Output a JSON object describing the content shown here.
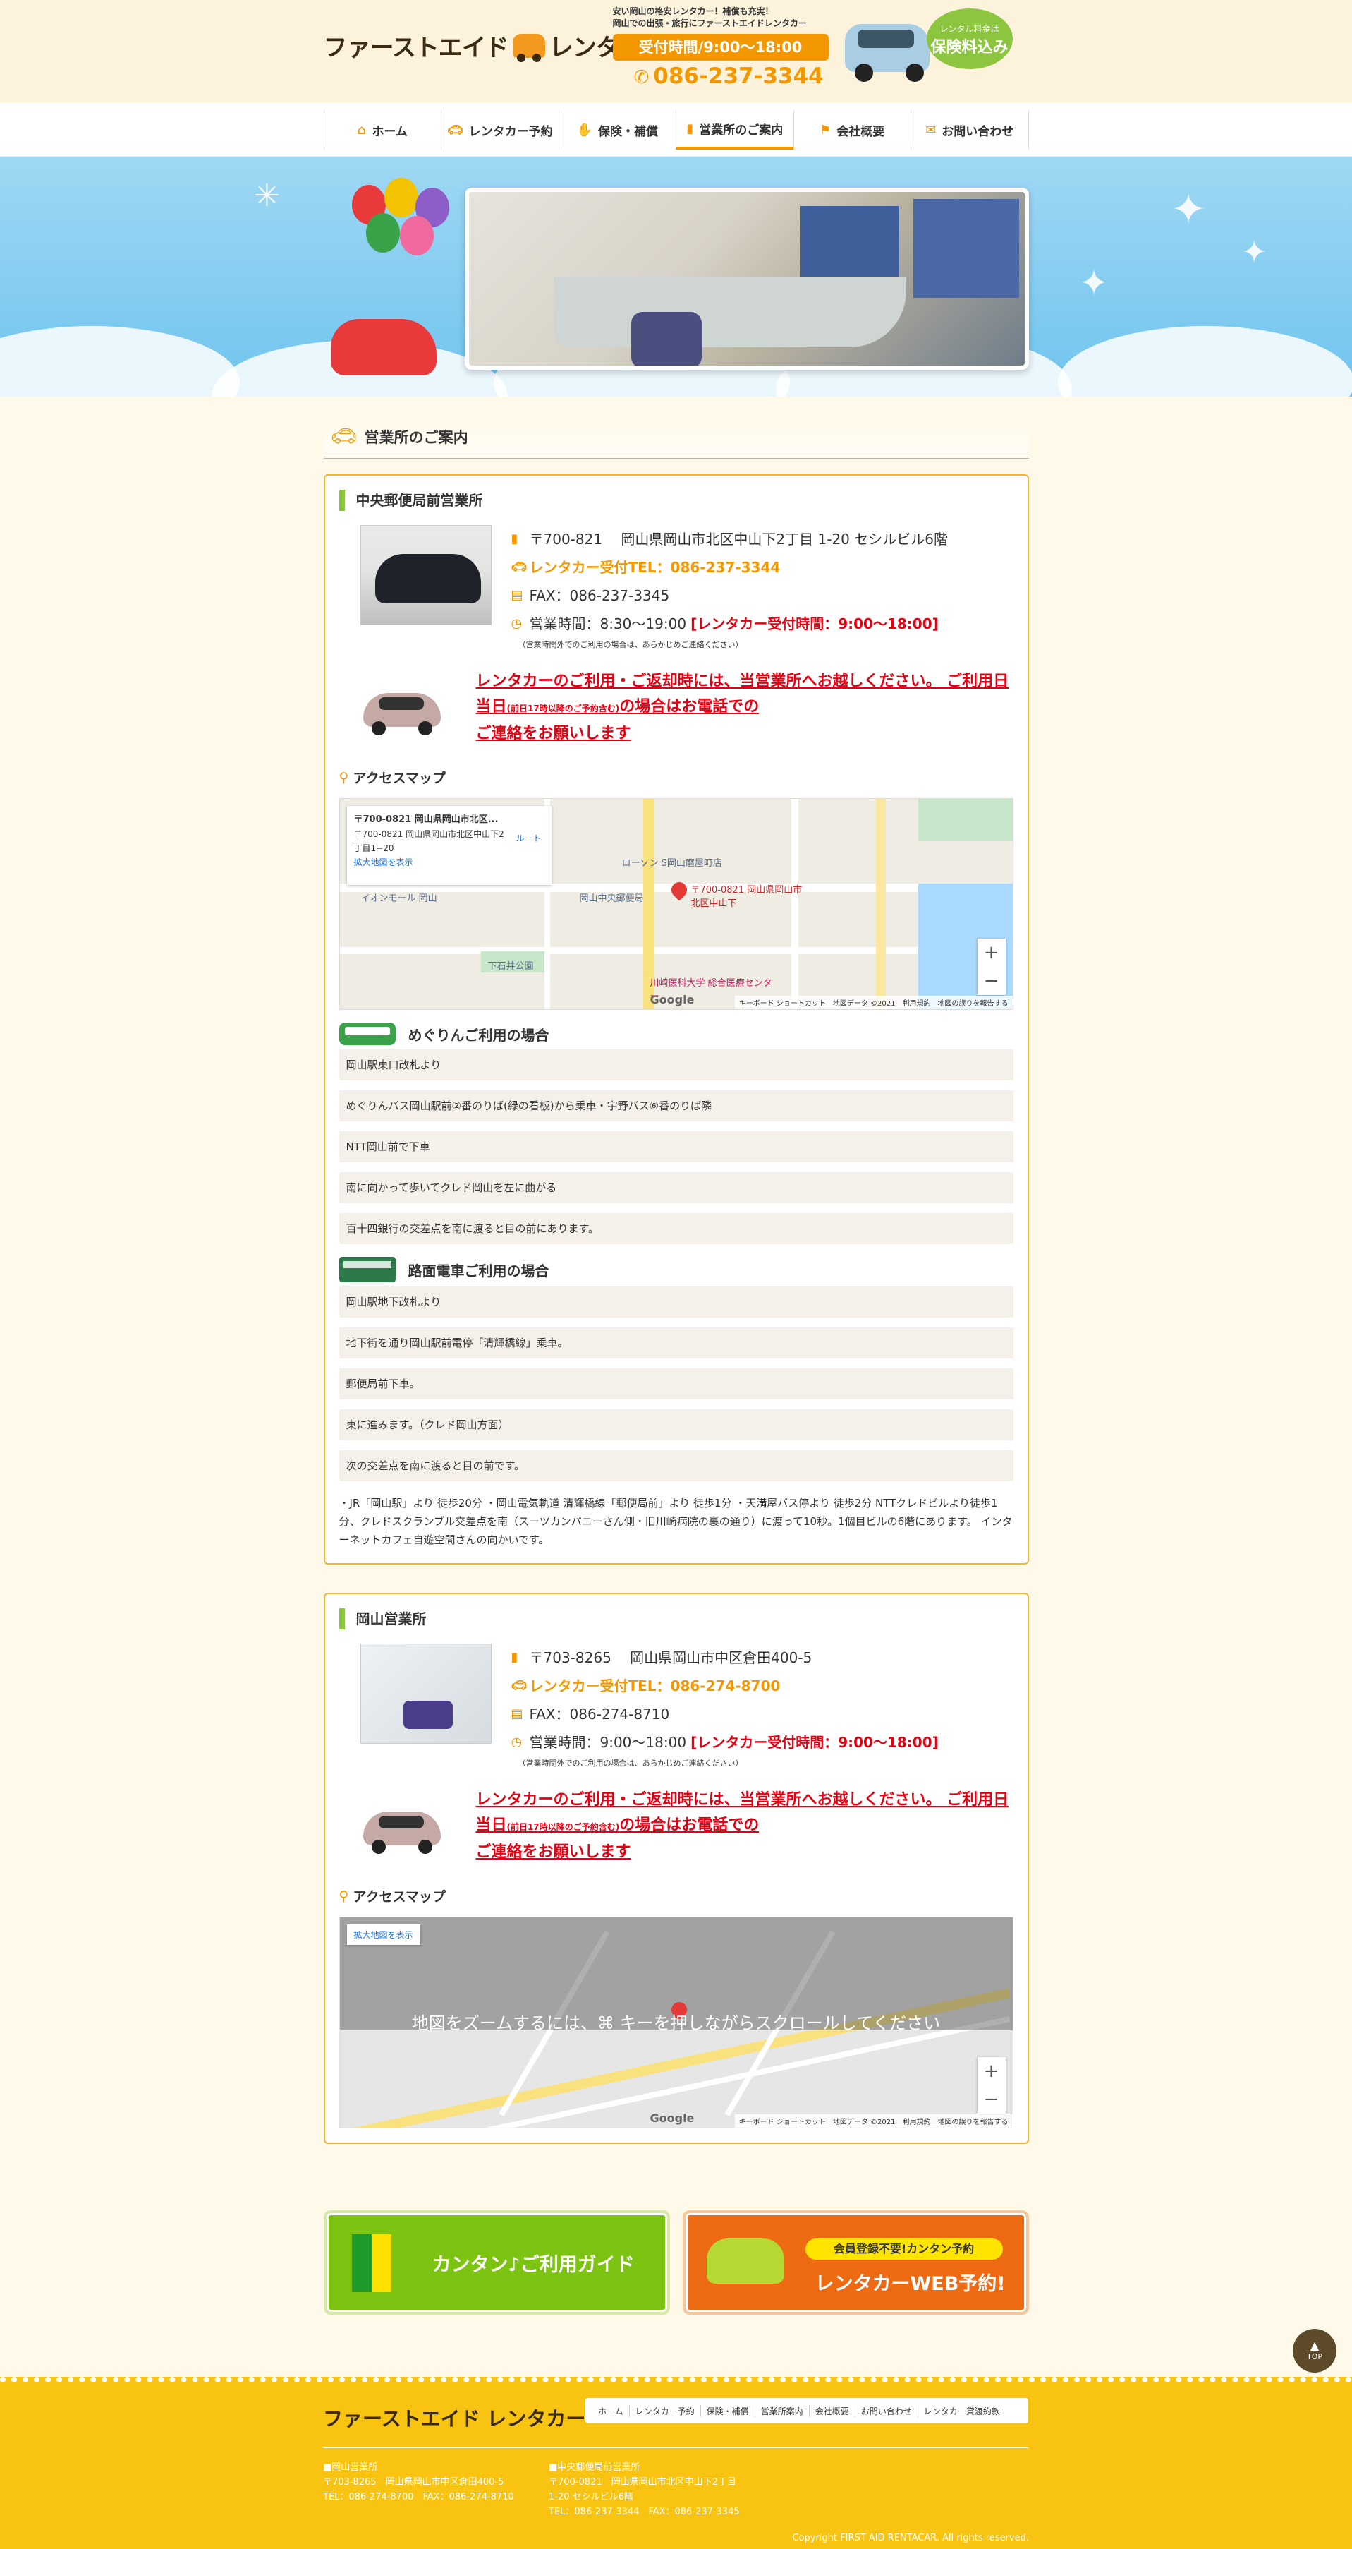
{
  "header": {
    "logo_text": "ファーストエイド",
    "logo_text2": "レンタカー",
    "tagline1": "安い岡山の格安レンタカー！補償も充実！",
    "tagline2": "岡山での出張・旅行にファーストエイドレンタカー",
    "hours": "受付時間/9:00〜18:00",
    "tel": "086-237-3344",
    "badge_small": "レンタル料金は",
    "badge_big": "保険料込み"
  },
  "nav": [
    {
      "label": "ホーム",
      "icon": "home-icon"
    },
    {
      "label": "レンタカー予約",
      "icon": "car-icon"
    },
    {
      "label": "保険・補償",
      "icon": "handshake-icon"
    },
    {
      "label": "営業所のご案内",
      "icon": "building-icon",
      "active": true
    },
    {
      "label": "会社概要",
      "icon": "sign-icon"
    },
    {
      "label": "お問い合わせ",
      "icon": "mail-icon"
    }
  ],
  "hero": {
    "balloon_text": "岡山での出張・旅行にファーストエイド"
  },
  "section_title": "営業所のご案内",
  "offices": [
    {
      "name": "中央郵便局前営業所",
      "address": "〒700-821　 岡山県岡山市北区中山下2丁目 1-20 セシルビル6階",
      "tel": "レンタカー受付TEL：086-237-3344",
      "fax": "FAX：086-237-3345",
      "hours": "営業時間：8:30〜19:00",
      "hours_red": "[レンタカー受付時間：9:00〜18:00]",
      "hours_note": "（営業時間外でのご利用の場合は、あらかじめご連絡ください）",
      "notice1": "レンタカーのご利用・ご返却時には、当営業所へお越しください。 ご利用日当日",
      "notice_small": "(前日17時以降のご予約含む)",
      "notice2": "の場合はお電話での",
      "notice3": "ご連絡をお願いします",
      "access_title": "アクセスマップ",
      "map_card_title": "〒700-0821 岡山県岡山市北区...",
      "map_card_addr": "〒700-0821 岡山県岡山市北区中山下2丁目1−20",
      "map_card_route": "ルート",
      "map_card_expand": "拡大地図を表示",
      "map_pin_label": "〒700-0821 岡山県岡山市北区中山下",
      "map_label_a": "イオンモール 岡山",
      "map_label_b": "岡山中央郵便局",
      "map_label_c": "下石井公園",
      "map_label_d": "ローソン S岡山磨屋町店",
      "map_label_e": "川崎医科大学 総合医療センター",
      "map_footer": "キーボード ショートカット　地図データ ©2021　利用規約　地図の誤りを報告する",
      "google": "Google",
      "bus_title": "めぐりんご利用の場合",
      "bus_steps": [
        "岡山駅東口改札より",
        "めぐりんバス岡山駅前②番のりば(緑の看板)から乗車・宇野バス⑥番のりば隣",
        "NTT岡山前で下車",
        "南に向かって歩いてクレド岡山を左に曲がる",
        "百十四銀行の交差点を南に渡ると目の前にあります。"
      ],
      "tram_title": "路面電車ご利用の場合",
      "tram_steps": [
        "岡山駅地下改札より",
        "地下街を通り岡山駅前電停「清輝橋線」乗車。",
        "郵便局前下車。",
        "東に進みます。（クレド岡山方面）",
        "次の交差点を南に渡ると目の前です。"
      ],
      "description": "・JR「岡山駅」より 徒歩20分 ・岡山電気軌道 清輝橋線「郵便局前」より 徒歩1分 ・天満屋バス停より 徒歩2分 NTTクレドビルより徒歩1分、クレドスクランブル交差点を南（スーツカンパニーさん側・旧川崎病院の裏の通り）に渡って10秒。1個目ビルの6階にあります。 インターネットカフェ自遊空間さんの向かいです。"
    },
    {
      "name": "岡山営業所",
      "address": "〒703-8265　 岡山県岡山市中区倉田400-5",
      "tel": "レンタカー受付TEL：086-274-8700",
      "fax": "FAX：086-274-8710",
      "hours": "営業時間：9:00〜18:00",
      "hours_red": "[レンタカー受付時間：9:00〜18:00]",
      "hours_note": "（営業時間外でのご利用の場合は、あらかじめご連絡ください）",
      "notice1": "レンタカーのご利用・ご返却時には、当営業所へお越しください。 ご利用日当日",
      "notice_small": "(前日17時以降のご予約含む)",
      "notice2": "の場合はお電話での",
      "notice3": "ご連絡をお願いします",
      "access_title": "アクセスマップ",
      "map_expand": "拡大地図を表示",
      "map_message": "地図をズームするには、⌘ キーを押しながらスクロールしてください",
      "map_footer": "キーボード ショートカット　地図データ ©2021　利用規約　地図の誤りを報告する",
      "google": "Google"
    }
  ],
  "banners": {
    "guide": "カンタン♪ご利用ガイド",
    "pill": "会員登録不要!カンタン予約",
    "reserve": "レンタカーWEB予約!"
  },
  "footer": {
    "logo": "ファーストエイド レンタカー",
    "links": [
      "ホーム",
      "レンタカー予約",
      "保険・補償",
      "営業所案内",
      "会社概要",
      "お問い合わせ",
      "レンタカー貸渡約款"
    ],
    "office1_name": "■岡山営業所",
    "office1_addr": "〒703-8265　岡山県岡山市中区倉田400-5",
    "office1_tel": "TEL：086-274-8700　FAX：086-274-8710",
    "office2_name": "■中央郵便局前営業所",
    "office2_addr": "〒700-0821　岡山県岡山市北区中山下2丁目 1-20 セシルビル6階",
    "office2_tel": "TEL：086-237-3344　FAX：086-237-3345",
    "copyright": "Copyright FIRST AID RENTACAR. All rights reserved.",
    "top": "TOP"
  }
}
